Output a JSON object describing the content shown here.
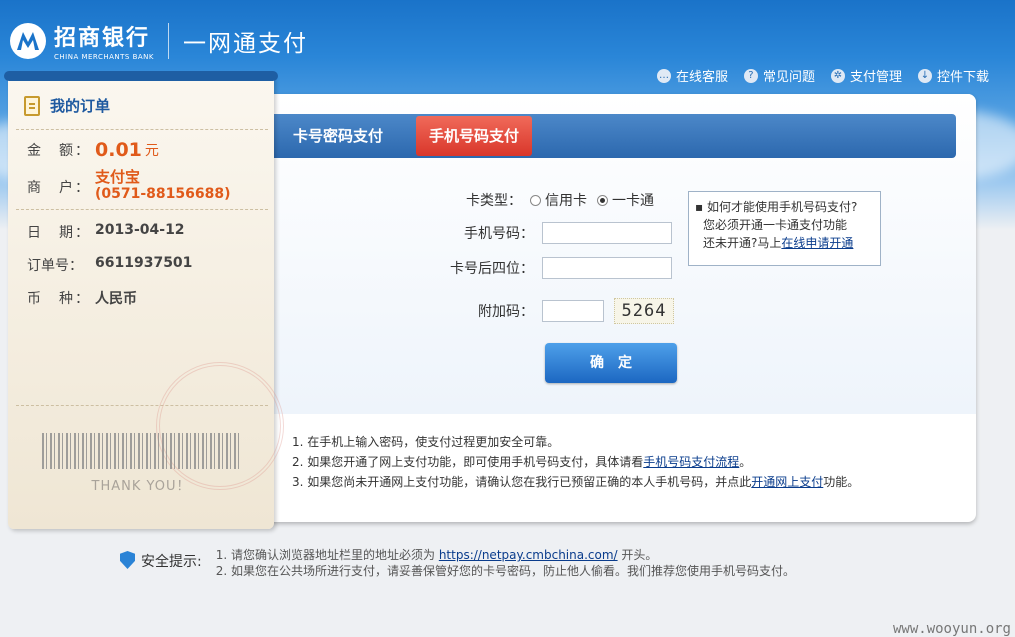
{
  "header": {
    "bank_name": "招商银行",
    "bank_name_en": "CHINA MERCHANTS BANK",
    "slogan": "一网通支付",
    "links": [
      {
        "icon": "chat-icon",
        "label": "在线客服"
      },
      {
        "icon": "question-icon",
        "label": "常见问题"
      },
      {
        "icon": "gear-icon",
        "label": "支付管理"
      },
      {
        "icon": "download-icon",
        "label": "控件下载"
      }
    ]
  },
  "order": {
    "title": "我的订单",
    "amount_label": "金　额：",
    "amount_value": "0.01",
    "amount_unit": "元",
    "merchant_label": "商　户：",
    "merchant_name": "支付宝",
    "merchant_phone": "(0571-88156688)",
    "date_label": "日　期：",
    "date_value": "2013-04-12",
    "order_no_label": "订单号：",
    "order_no_value": "6611937501",
    "currency_label": "币　种：",
    "currency_value": "人民币",
    "thanks": "THANK YOU！"
  },
  "tabs": [
    {
      "label": "卡号密码支付",
      "active": false
    },
    {
      "label": "手机号码支付",
      "active": true
    }
  ],
  "form": {
    "card_type_label": "卡类型：",
    "card_type_options": [
      "信用卡",
      "一卡通"
    ],
    "card_type_selected": "一卡通",
    "phone_label": "手机号码：",
    "phone_value": "",
    "card_last4_label": "卡号后四位：",
    "card_last4_value": "",
    "captcha_label": "附加码：",
    "captcha_value": "",
    "captcha_image_text": "5264",
    "confirm_label": "确定"
  },
  "help": {
    "question": "如何才能使用手机号码支付?",
    "line1": "您必须开通一卡通支付功能",
    "line2_prefix": "还未开通?马上",
    "line2_link": "在线申请开通"
  },
  "notes": {
    "n1": "1. 在手机上输入密码，使支付过程更加安全可靠。",
    "n2_prefix": "2. 如果您开通了网上支付功能，即可使用手机号码支付，具体请看",
    "n2_link": "手机号码支付流程",
    "n2_suffix": "。",
    "n3_prefix": "3. 如果您尚未开通网上支付功能，请确认您在我行已预留正确的本人手机号码，并点此",
    "n3_link": "开通网上支付",
    "n3_suffix": "功能。"
  },
  "security": {
    "title": "安全提示:",
    "l1_prefix": "1. 请您确认浏览器地址栏里的地址必须为 ",
    "l1_link": "https://netpay.cmbchina.com/",
    "l1_suffix": " 开头。",
    "l2": "2. 如果您在公共场所进行支付，请妥善保管好您的卡号密码，防止他人偷看。我们推荐您使用手机号码支付。"
  },
  "watermark": "www.wooyun.org",
  "colors": {
    "brand_blue": "#1a73c9",
    "active_tab": "#e0463a",
    "amount": "#e05a1a"
  }
}
